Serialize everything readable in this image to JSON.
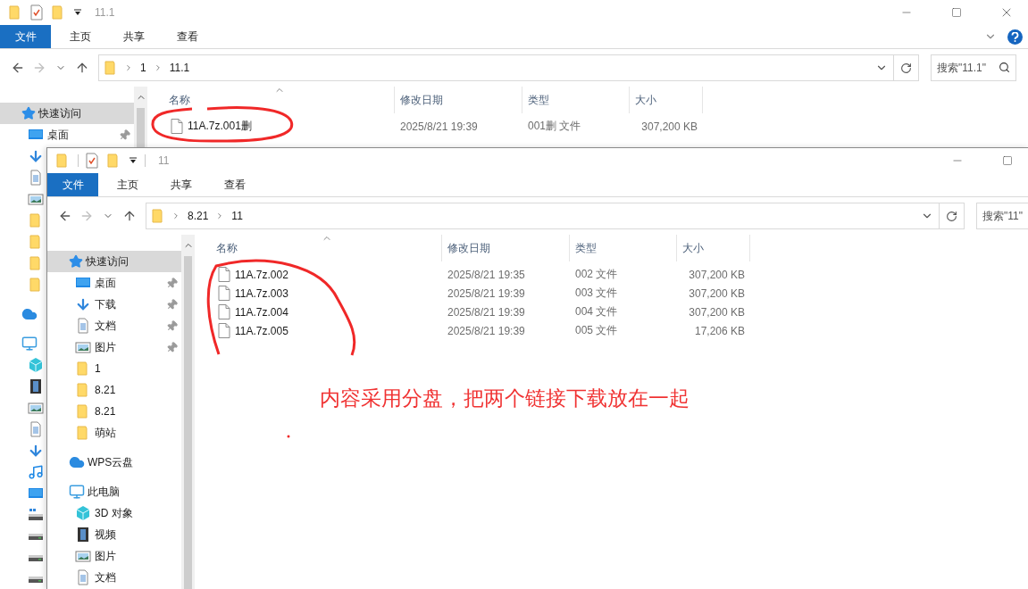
{
  "windows": [
    {
      "title": "11.1",
      "clipped_right": false,
      "ribbon_tabs": [
        {
          "label": "文件",
          "selected": true
        },
        {
          "label": "主页",
          "selected": false
        },
        {
          "label": "共享",
          "selected": false
        },
        {
          "label": "查看",
          "selected": false
        }
      ],
      "path": [
        "1",
        "11.1"
      ],
      "search": {
        "placeholder": "搜索\"11.1\""
      },
      "sidebar": [
        {
          "label": "快速访问",
          "kind": "star",
          "selected": true,
          "children": [
            {
              "label": "桌面",
              "kind": "desktop",
              "pinned": true,
              "selected": false
            },
            {
              "kind": "download",
              "pinned": false,
              "selected": false
            },
            {
              "kind": "document",
              "pinned": false,
              "selected": false
            },
            {
              "kind": "pictures",
              "pinned": false,
              "selected": false
            },
            {
              "kind": "folder",
              "pinned": false,
              "selected": false
            },
            {
              "kind": "folder",
              "pinned": false,
              "selected": false
            },
            {
              "kind": "folder",
              "pinned": false,
              "selected": false
            },
            {
              "kind": "folder",
              "pinned": false,
              "selected": false
            }
          ]
        },
        {
          "kind": "cloud",
          "selected": false
        },
        {
          "kind": "pc",
          "selected": false,
          "children": [
            {
              "kind": "cube",
              "pinned": false,
              "selected": false
            },
            {
              "kind": "video",
              "pinned": false,
              "selected": false
            },
            {
              "kind": "pictures",
              "pinned": false,
              "selected": false
            },
            {
              "kind": "document",
              "pinned": false,
              "selected": false
            },
            {
              "kind": "download",
              "pinned": false,
              "selected": false
            },
            {
              "kind": "music",
              "pinned": false,
              "selected": false
            },
            {
              "kind": "desktop",
              "pinned": false,
              "selected": false
            },
            {
              "kind": "netdrive",
              "pinned": false,
              "selected": false
            },
            {
              "kind": "drive",
              "pinned": false,
              "selected": false
            },
            {
              "kind": "drive",
              "pinned": false,
              "selected": false
            },
            {
              "kind": "drive",
              "pinned": false,
              "selected": false
            }
          ]
        }
      ],
      "columns": [
        "名称",
        "修改日期",
        "类型",
        "大小"
      ],
      "files": [
        {
          "name": "11A.7z.001删",
          "date": "2025/8/21 19:39",
          "type": "001删 文件",
          "size": "307,200 KB"
        }
      ]
    },
    {
      "title": "11",
      "clipped_right": true,
      "ribbon_tabs": [
        {
          "label": "文件",
          "selected": true
        },
        {
          "label": "主页",
          "selected": false
        },
        {
          "label": "共享",
          "selected": false
        },
        {
          "label": "查看",
          "selected": false
        }
      ],
      "path": [
        "8.21",
        "11"
      ],
      "search": {
        "placeholder": "搜索\"11\""
      },
      "sidebar": [
        {
          "label": "快速访问",
          "kind": "star",
          "selected": true,
          "children": [
            {
              "label": "桌面",
              "kind": "desktop",
              "pinned": true,
              "selected": false
            },
            {
              "label": "下载",
              "kind": "download",
              "pinned": true,
              "selected": false
            },
            {
              "label": "文档",
              "kind": "document",
              "pinned": true,
              "selected": false
            },
            {
              "label": "图片",
              "kind": "pictures",
              "pinned": true,
              "selected": false
            },
            {
              "label": "1",
              "kind": "folder",
              "pinned": false,
              "selected": false
            },
            {
              "label": "8.21",
              "kind": "folder",
              "pinned": false,
              "selected": false
            },
            {
              "label": "8.21",
              "kind": "folder",
              "pinned": false,
              "selected": false
            },
            {
              "label": "萌站",
              "kind": "folder",
              "pinned": false,
              "selected": false
            }
          ]
        },
        {
          "label": "WPS云盘",
          "kind": "cloud",
          "selected": false
        },
        {
          "label": "此电脑",
          "kind": "pc",
          "selected": false,
          "children": [
            {
              "label": "3D 对象",
              "kind": "cube",
              "pinned": false,
              "selected": false
            },
            {
              "label": "视频",
              "kind": "video",
              "pinned": false,
              "selected": false
            },
            {
              "label": "图片",
              "kind": "pictures",
              "pinned": false,
              "selected": false
            },
            {
              "label": "文档",
              "kind": "document",
              "pinned": false,
              "selected": false
            }
          ]
        }
      ],
      "columns": [
        "名称",
        "修改日期",
        "类型",
        "大小"
      ],
      "files": [
        {
          "name": "11A.7z.002",
          "date": "2025/8/21 19:35",
          "type": "002 文件",
          "size": "307,200 KB"
        },
        {
          "name": "11A.7z.003",
          "date": "2025/8/21 19:39",
          "type": "003 文件",
          "size": "307,200 KB"
        },
        {
          "name": "11A.7z.004",
          "date": "2025/8/21 19:39",
          "type": "004 文件",
          "size": "307,200 KB"
        },
        {
          "name": "11A.7z.005",
          "date": "2025/8/21 19:39",
          "type": "005 文件",
          "size": "17,206 KB"
        }
      ]
    }
  ],
  "annotation": {
    "text": "内容采用分盘，把两个链接下载放在一起"
  }
}
